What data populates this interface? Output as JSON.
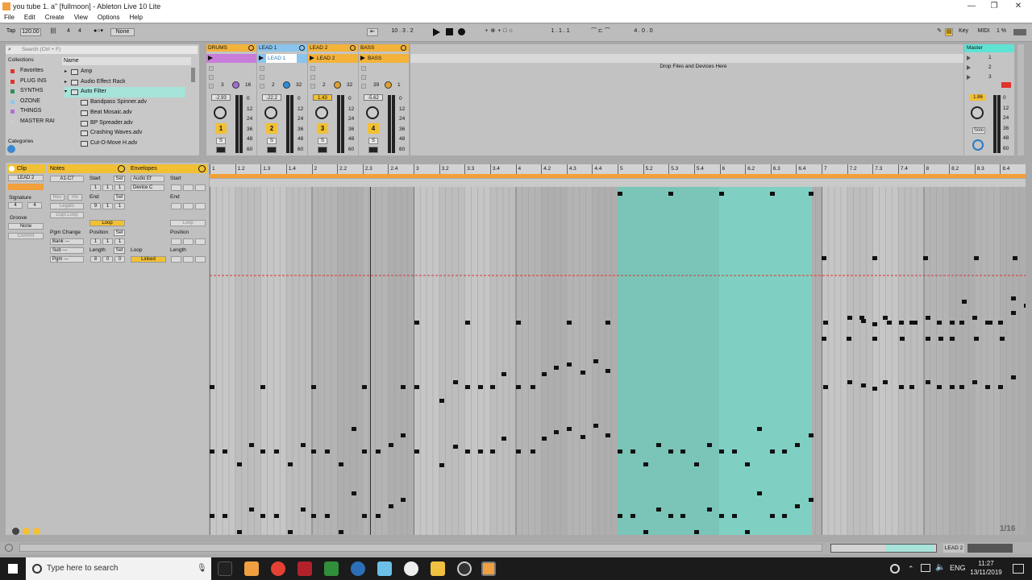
{
  "window": {
    "title": "you tube 1. a\" [fullmoon] - Ableton Live 10 Lite",
    "minimize": "—",
    "maximize": "❐",
    "close": "✕"
  },
  "menu": [
    "File",
    "Edit",
    "Create",
    "View",
    "Options",
    "Help"
  ],
  "toolbar": {
    "tempo_label": "Tap",
    "tempo": "120.00",
    "tapbars": "|||| ",
    "signature_num": "4",
    "signature_den": "4",
    "quantize": "None",
    "position": "10 .  3 .  2",
    "loop_start": "1 .  1 .  1",
    "loop_length": "4 .  0 .  0",
    "key": "Key",
    "midi": "MIDI",
    "cpu": "1 %"
  },
  "browser": {
    "search_placeholder": "Search (Ctrl + F)",
    "collections_label": "Collections",
    "name_header": "Name",
    "categories_label": "Categories",
    "collections": [
      {
        "label": "Favorites",
        "color": "#e0332a"
      },
      {
        "label": "PLUG INS",
        "color": "#e0332a"
      },
      {
        "label": "SYNTHS",
        "color": "#2a8f5a"
      },
      {
        "label": "OZONE",
        "color": "#8fc7f0"
      },
      {
        "label": "THINGS",
        "color": "#b270d6"
      },
      {
        "label": "MASTER RAI",
        "color": "#cccccc"
      }
    ],
    "items": [
      {
        "label": "Amp",
        "folder": true
      },
      {
        "label": "Audio Effect Rack",
        "folder": true
      },
      {
        "label": "Auto Filter",
        "folder": true,
        "selected": true
      },
      {
        "label": "Bandpass Spinner.adv",
        "folder": false
      },
      {
        "label": "Beat Mosaic.adv",
        "folder": false
      },
      {
        "label": "BP Spreader.adv",
        "folder": false
      },
      {
        "label": "Crashing Waves.adv",
        "folder": false
      },
      {
        "label": "Cut-O-Move H.adv",
        "folder": false
      }
    ]
  },
  "tracks": [
    {
      "name": "DRUMS",
      "color": "#f3b33a",
      "clip_color": "#c87dd8",
      "clip_name": "",
      "num": "1",
      "vol": "-2.93",
      "sends": [
        "3",
        "16"
      ]
    },
    {
      "name": "LEAD 1",
      "color": "#89c4ee",
      "clip_color": "#89c4ee",
      "clip_name": "LEAD 1",
      "num": "2",
      "vol": "-22.2",
      "sends": [
        "2",
        "32"
      ]
    },
    {
      "name": "LEAD 2",
      "color": "#f3b33a",
      "clip_color": "#f3b33a",
      "clip_name": "LEAD 2",
      "num": "3",
      "vol": "1.43",
      "sends": [
        "2",
        "32"
      ]
    },
    {
      "name": "BASS",
      "color": "#f3b33a",
      "clip_color": "#f3b33a",
      "clip_name": "BASS",
      "num": "4",
      "vol": "-5.62",
      "sends": [
        "39",
        "1"
      ]
    }
  ],
  "drop_text": "Drop Files and Devices Here",
  "master": {
    "name": "Master",
    "scenes": [
      "1",
      "2",
      "3"
    ],
    "vol": "1.86",
    "solo": "Solo"
  },
  "meter_scale": [
    "0",
    "12",
    "24",
    "36",
    "48",
    "60"
  ],
  "clip": {
    "title": "Clip",
    "name": "LEAD 2",
    "signature_label": "Signature",
    "sig_num": "4",
    "sig_den": "4",
    "groove_label": "Groove",
    "groove_value": "None",
    "commit": "Commit"
  },
  "notes": {
    "title": "Notes",
    "range": "A1-C7",
    "start_label": "Start",
    "end_label": "End",
    "set": "Set",
    "start": [
      "1",
      "1",
      "1"
    ],
    "end": [
      "9",
      "1",
      "1"
    ],
    "rev": "Rev",
    "inv": "Inv",
    "legato": "Legato",
    "dupl": "Dupl.Loop",
    "loop": "Loop",
    "pgm_change": "Pgm Change",
    "bank": "Bank ---",
    "sub": "Sub ---",
    "pgm": "Pgm ---",
    "position_label": "Position",
    "position": [
      "1",
      "1",
      "1"
    ],
    "length_label": "Length",
    "length": [
      "8",
      "0",
      "0"
    ]
  },
  "envelopes": {
    "title": "Envelopes",
    "device": "Audio Ef",
    "control": "Device C",
    "start_label": "Start",
    "end_label": "End",
    "loop_label": "Loop",
    "linked": "Linked",
    "loop": "Loop",
    "position_label": "Position",
    "length_label": "Length"
  },
  "ruler": [
    "1",
    "1.2",
    "1.3",
    "1.4",
    "2",
    "2.2",
    "2.3",
    "2.4",
    "3",
    "3.2",
    "3.3",
    "3.4",
    "4",
    "4.2",
    "4.3",
    "4.4",
    "5",
    "5.2",
    "5.3",
    "5.4",
    "6",
    "6.2",
    "6.3",
    "6.4",
    "7",
    "7.2",
    "7.3",
    "7.4",
    "8",
    "8.2",
    "8.3",
    "8.4"
  ],
  "grid_label": "1/16",
  "status_track": "LEAD 2",
  "taskbar": {
    "search": "Type here to search",
    "lang": "ENG",
    "time": "11:27",
    "date": "13/11/2019"
  }
}
